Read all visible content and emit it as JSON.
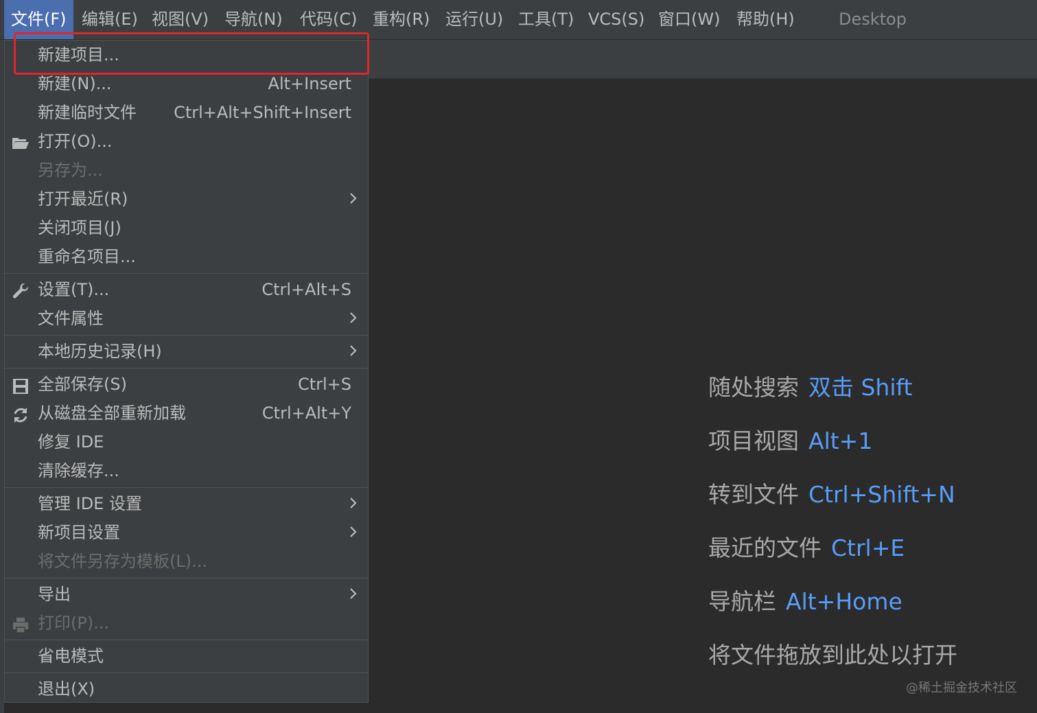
{
  "menubar": {
    "items": [
      "文件(F)",
      "编辑(E)",
      "视图(V)",
      "导航(N)",
      "代码(C)",
      "重构(R)",
      "运行(U)",
      "工具(T)",
      "VCS(S)",
      "窗口(W)",
      "帮助(H)"
    ],
    "title": "Desktop"
  },
  "file_menu": {
    "new_project": "新建项目...",
    "new": {
      "label": "新建(N)...",
      "shortcut": "Alt+Insert"
    },
    "new_scratch": {
      "label": "新建临时文件",
      "shortcut": "Ctrl+Alt+Shift+Insert"
    },
    "open": "打开(O)...",
    "save_as": "另存为...",
    "open_recent": "打开最近(R)",
    "close_project": "关闭项目(J)",
    "rename_project": "重命名项目...",
    "settings": {
      "label": "设置(T)...",
      "shortcut": "Ctrl+Alt+S"
    },
    "file_properties": "文件属性",
    "local_history": "本地历史记录(H)",
    "save_all": {
      "label": "全部保存(S)",
      "shortcut": "Ctrl+S"
    },
    "reload_all": {
      "label": "从磁盘全部重新加载",
      "shortcut": "Ctrl+Alt+Y"
    },
    "repair_ide": "修复 IDE",
    "invalidate_caches": "清除缓存...",
    "manage_ide_settings": "管理 IDE 设置",
    "new_project_settings": "新项目设置",
    "save_as_template": "将文件另存为模板(L)...",
    "export": "导出",
    "print": "打印(P)...",
    "power_save": "省电模式",
    "exit": "退出(X)"
  },
  "hints": [
    {
      "label": "随处搜索",
      "key": "双击 Shift"
    },
    {
      "label": "项目视图",
      "key": "Alt+1"
    },
    {
      "label": "转到文件",
      "key": "Ctrl+Shift+N"
    },
    {
      "label": "最近的文件",
      "key": "Ctrl+E"
    },
    {
      "label": "导航栏",
      "key": "Alt+Home"
    },
    {
      "label": "将文件拖放到此处以打开",
      "key": ""
    }
  ],
  "watermark": "@稀土掘金技术社区",
  "colors": {
    "accent": "#4b6eaf",
    "highlight_box": "#e0262a",
    "shortcut_text": "#589df6"
  }
}
